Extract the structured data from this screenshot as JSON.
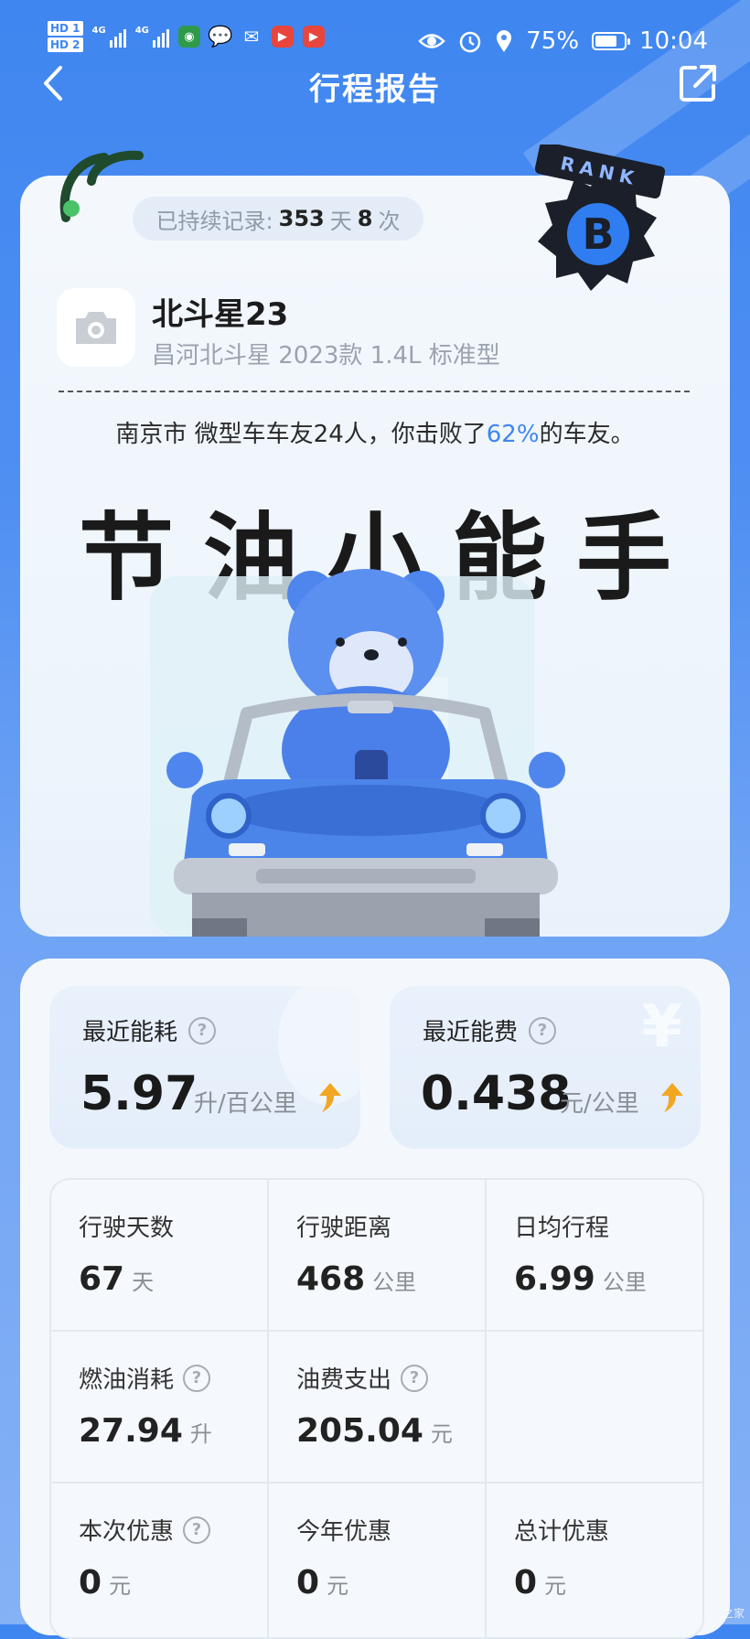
{
  "status_bar": {
    "hd1": "HD 1",
    "hd2": "HD 2",
    "net1": "4G",
    "net2": "4G",
    "battery_pct": "75%",
    "time": "10:04",
    "battery_level": 0.75
  },
  "header": {
    "title": "行程报告"
  },
  "record": {
    "prefix": "已持续记录:",
    "days": "353",
    "days_unit": "天",
    "count": "8",
    "count_unit": "次"
  },
  "badge": {
    "rank_word": "RANK",
    "grade": "B"
  },
  "car": {
    "name": "北斗星23",
    "model": "昌河北斗星 2023款 1.4L 标准型"
  },
  "ranking": {
    "before": "南京市 微型车车友24人，你击败了",
    "percent": "62%",
    "after": "的车友。"
  },
  "headline": "节油小能手",
  "metrics": [
    {
      "label": "最近能耗",
      "value": "5.97",
      "unit": "升/百公里"
    },
    {
      "label": "最近能费",
      "value": "0.438",
      "unit": "元/公里",
      "watermark": "¥"
    }
  ],
  "stats": [
    {
      "label": "行驶天数",
      "value": "67",
      "unit": "天",
      "help": false
    },
    {
      "label": "行驶距离",
      "value": "468",
      "unit": "公里",
      "help": false
    },
    {
      "label": "日均行程",
      "value": "6.99",
      "unit": "公里",
      "help": false
    },
    {
      "label": "燃油消耗",
      "value": "27.94",
      "unit": "升",
      "help": true
    },
    {
      "label": "油费支出",
      "value": "205.04",
      "unit": "元",
      "help": true
    },
    {
      "label": "",
      "value": "",
      "unit": "",
      "help": false
    },
    {
      "label": "本次优惠",
      "value": "0",
      "unit": "元",
      "help": true
    },
    {
      "label": "今年优惠",
      "value": "0",
      "unit": "元",
      "help": false
    },
    {
      "label": "总计优惠",
      "value": "0",
      "unit": "元",
      "help": false
    }
  ],
  "help_glyph": "?",
  "corner_watermark": "之家",
  "colors": {
    "accent": "#3f86f0",
    "arrow": "#f2a622"
  }
}
